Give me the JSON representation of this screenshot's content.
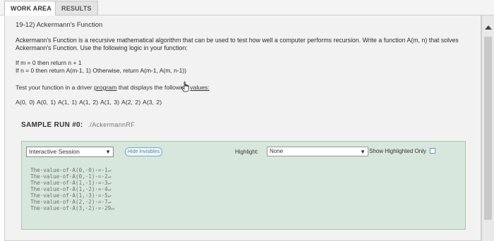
{
  "tabs": [
    {
      "label": "WORK AREA"
    },
    {
      "label": "RESULTS"
    }
  ],
  "problem": {
    "title": "19-12) Ackermann's Function",
    "description": "Ackermann's Function is a recursive mathematical algorithm that can be used to test how well a computer performs recursion. Write a function A(m, n) that solves Ackermann's Function. Use the following logic in your function:",
    "rules": [
      "If m = 0 then return n + 1",
      "If n = 0 then return A(m-1, 1) Otherwise, return A(m-1, A(m, n-1))"
    ],
    "test_prefix": "Test your function in a driver",
    "test_link_program": "program",
    "test_middle": "that displays the following",
    "test_link_values": "values:",
    "calls": "A(0, 0) A(0, 1) A(1, 1) A(1, 2) A(1, 3) A(2, 2) A(3, 2)"
  },
  "sample_run": {
    "label": "SAMPLE RUN #0:",
    "path": "./AckermannRF"
  },
  "session": {
    "mode": "Interactive Session",
    "hide_button": "Hide Invisibles",
    "highlight_label": "Highlight:",
    "highlight_value": "None",
    "show_highlighted_label": "Show Highlighted Only",
    "output_lines": [
      "The·value·of·A(0,·0)·=·1↵",
      "The·value·of·A(0,·1)·=·2↵",
      "The·value·of·A(1,·1)·=·3↵",
      "The·value·of·A(1,·2)·=·4↵",
      "The·value·of·A(1,·3)·=·5↵",
      "The·value·of·A(2,·2)·=·7↵",
      "The·value·of·A(3,·2)·=·29↵"
    ]
  },
  "icons": {
    "cursor": "hand-pointer-icon",
    "scroll_up": "triangle-up-icon",
    "dropdown": "chevron-down-icon"
  },
  "colors": {
    "session_bg": "#d7e7dc",
    "link_blue": "#5a8aa8"
  }
}
